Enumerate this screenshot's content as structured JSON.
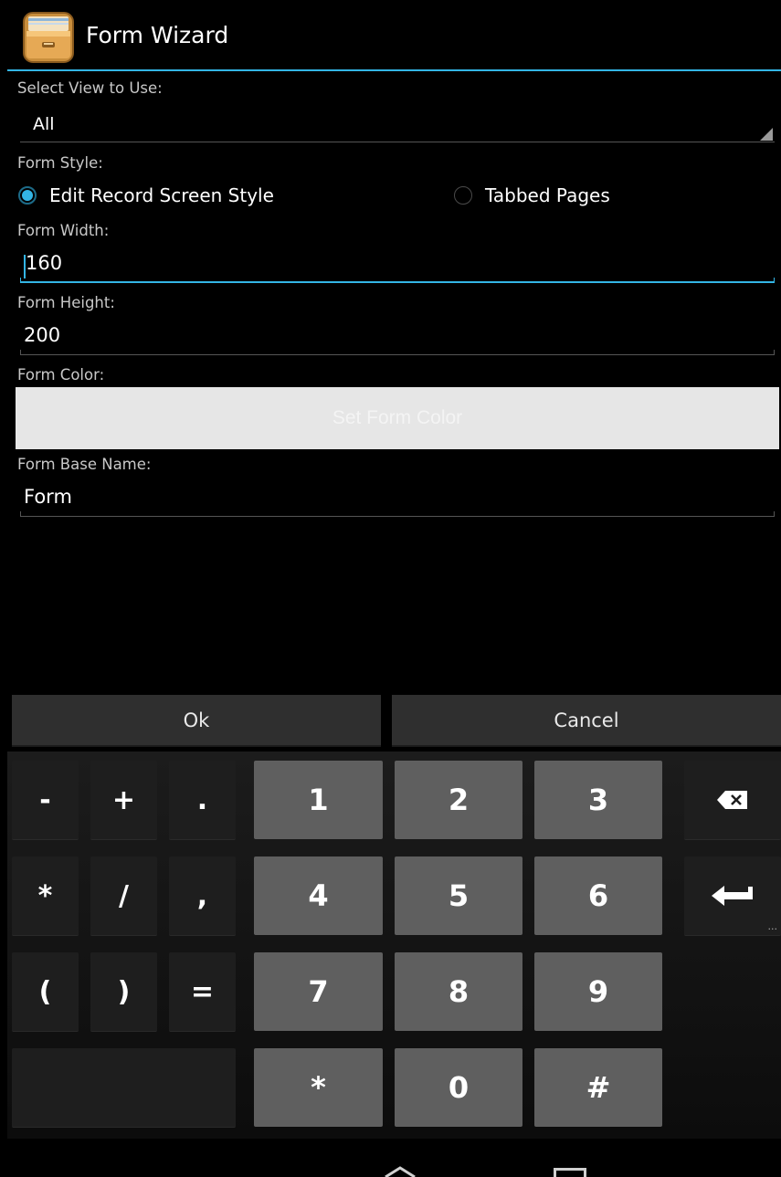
{
  "titlebar": {
    "title": "Form Wizard",
    "icon": "drawer-icon",
    "accent": "#33b5e5"
  },
  "view_select": {
    "label": "Select View to Use:",
    "value": "All"
  },
  "form_style": {
    "label": "Form Style:",
    "options": [
      {
        "label": "Edit Record Screen Style",
        "selected": true
      },
      {
        "label": "Tabbed Pages",
        "selected": false
      }
    ]
  },
  "form_width": {
    "label": "Form Width:",
    "value": "160"
  },
  "form_height": {
    "label": "Form Height:",
    "value": "200"
  },
  "form_color": {
    "label": "Form Color:",
    "button": "Set Form Color"
  },
  "form_base_name": {
    "label": "Form Base Name:",
    "value": "Form"
  },
  "buttons": {
    "ok": "Ok",
    "cancel": "Cancel"
  },
  "keyboard": {
    "keys": [
      "-",
      "+",
      ".",
      "1",
      "2",
      "3",
      "*",
      "/",
      ",",
      "4",
      "5",
      "6",
      "(",
      ")",
      "=",
      "7",
      "8",
      "9",
      "*",
      "0",
      "#"
    ],
    "icons": {
      "backspace": "backspace-icon",
      "enter": "enter-icon"
    }
  },
  "navbar": {
    "icons": [
      "home-icon",
      "recent-apps-icon"
    ]
  }
}
